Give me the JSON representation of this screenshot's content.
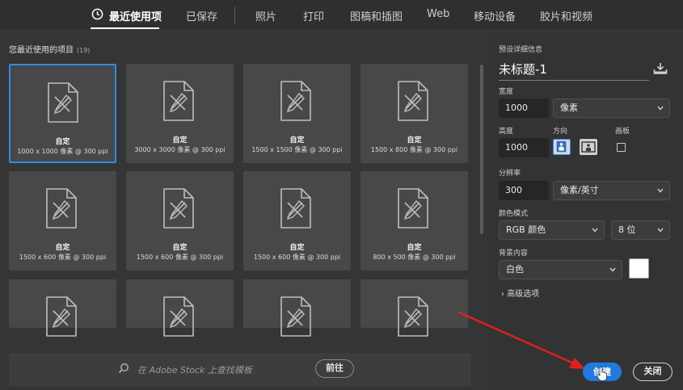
{
  "tabs": [
    {
      "label": "最近使用项",
      "active": true
    },
    {
      "label": "已保存",
      "active": false
    },
    {
      "label": "照片",
      "active": false
    },
    {
      "label": "打印",
      "active": false
    },
    {
      "label": "图稿和插图",
      "active": false
    },
    {
      "label": "Web",
      "active": false
    },
    {
      "label": "移动设备",
      "active": false
    },
    {
      "label": "胶片和视频",
      "active": false
    }
  ],
  "recent": {
    "title": "您最近使用的项目",
    "count": "(19)",
    "items": [
      {
        "name": "自定",
        "dims": "1000 x 1000 像素 @ 300 ppi",
        "selected": true
      },
      {
        "name": "自定",
        "dims": "3000 x 3000 像素 @ 300 ppi",
        "selected": false
      },
      {
        "name": "自定",
        "dims": "1500 x 1500 像素 @ 300 ppi",
        "selected": false
      },
      {
        "name": "自定",
        "dims": "1500 x 800 像素 @ 300 ppi",
        "selected": false
      },
      {
        "name": "自定",
        "dims": "1500 x 600 像素 @ 300 ppi",
        "selected": false
      },
      {
        "name": "自定",
        "dims": "1500 x 600 像素 @ 300 ppi",
        "selected": false
      },
      {
        "name": "自定",
        "dims": "1500 x 600 像素 @ 300 ppi",
        "selected": false
      },
      {
        "name": "自定",
        "dims": "800 x 500 像素 @ 300 ppi",
        "selected": false
      },
      {
        "name": "",
        "dims": "",
        "selected": false
      },
      {
        "name": "",
        "dims": "",
        "selected": false
      },
      {
        "name": "",
        "dims": "",
        "selected": false
      },
      {
        "name": "",
        "dims": "",
        "selected": false
      }
    ]
  },
  "stock": {
    "placeholder": "在 Adobe Stock 上查找模板",
    "go_label": "前往"
  },
  "preset": {
    "section_title": "预设详细信息",
    "doc_name": "未标题-1",
    "width_label": "宽度",
    "width_value": "1000",
    "width_unit": "像素",
    "height_label": "高度",
    "height_value": "1000",
    "orientation_label": "方向",
    "artboard_label": "画板",
    "resolution_label": "分辨率",
    "resolution_value": "300",
    "resolution_unit": "像素/英寸",
    "color_mode_label": "颜色模式",
    "color_mode_value": "RGB 颜色",
    "bit_depth_value": "8 位",
    "background_label": "背景内容",
    "background_value": "白色",
    "background_color": "#ffffff",
    "advanced_label": "高级选项"
  },
  "actions": {
    "create_label": "创建",
    "close_label": "关闭"
  },
  "colors": {
    "accent": "#1f7ae0",
    "selected_border": "#2d8ceb",
    "annotation_arrow": "#e02020"
  },
  "icons": {
    "recent_tab": "clock-icon",
    "document": "document-pencil-icon",
    "search": "search-icon",
    "save_preset": "save-preset-icon",
    "portrait": "portrait-orientation-icon",
    "landscape": "landscape-orientation-icon"
  }
}
